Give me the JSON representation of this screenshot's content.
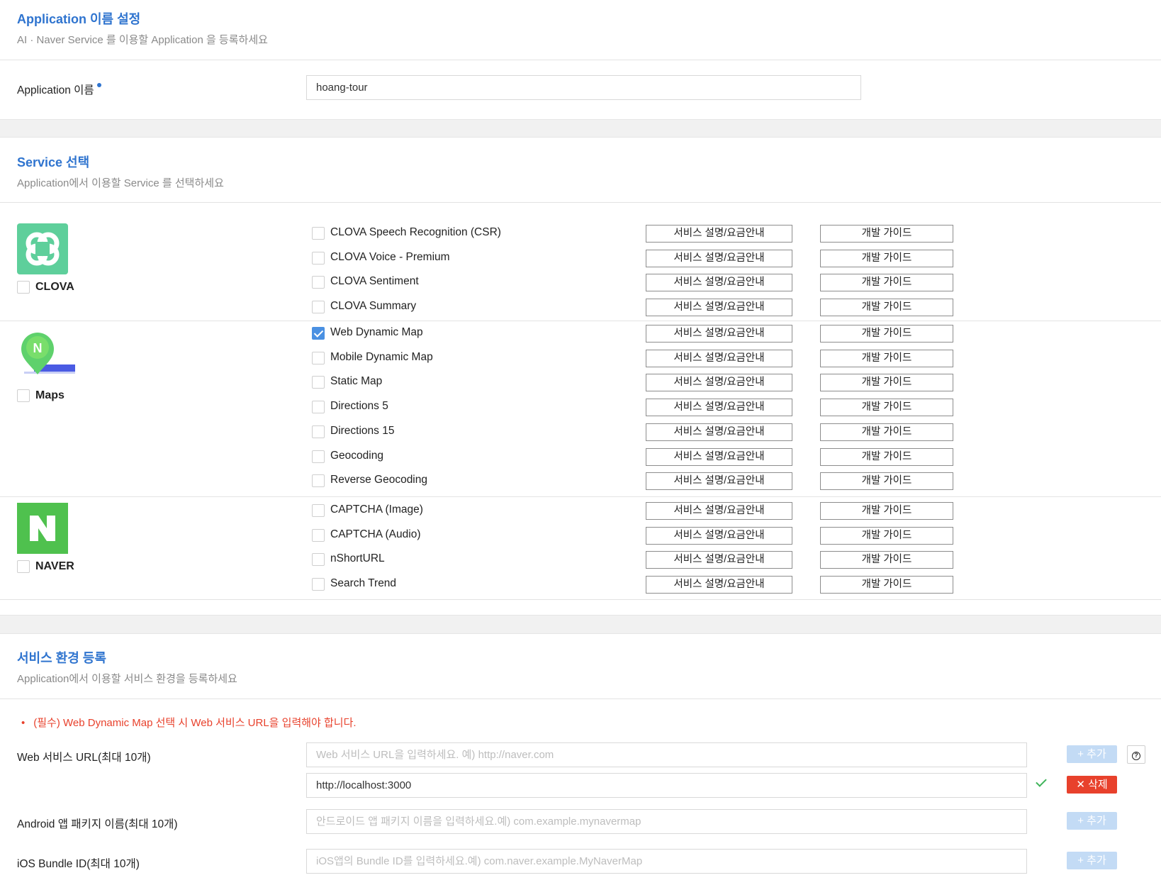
{
  "app_name_section": {
    "title": "Application 이름 설정",
    "desc": "AI · Naver Service 를 이용할 Application 을 등록하세요",
    "label": "Application 이름",
    "value": "hoang-tour"
  },
  "service_section": {
    "title": "Service 선택",
    "desc": "Application에서 이용할 Service 를 선택하세요",
    "desc_btn": "서비스 설명/요금안내",
    "guide_btn": "개발 가이드",
    "groups": [
      {
        "name": "CLOVA",
        "services": [
          {
            "name": "CLOVA Speech Recognition (CSR)",
            "checked": false
          },
          {
            "name": "CLOVA Voice - Premium",
            "checked": false
          },
          {
            "name": "CLOVA Sentiment",
            "checked": false
          },
          {
            "name": "CLOVA Summary",
            "checked": false
          }
        ]
      },
      {
        "name": "Maps",
        "services": [
          {
            "name": "Web Dynamic Map",
            "checked": true
          },
          {
            "name": "Mobile Dynamic Map",
            "checked": false
          },
          {
            "name": "Static Map",
            "checked": false
          },
          {
            "name": "Directions 5",
            "checked": false
          },
          {
            "name": "Directions 15",
            "checked": false
          },
          {
            "name": "Geocoding",
            "checked": false
          },
          {
            "name": "Reverse Geocoding",
            "checked": false
          }
        ]
      },
      {
        "name": "NAVER",
        "services": [
          {
            "name": "CAPTCHA (Image)",
            "checked": false
          },
          {
            "name": "CAPTCHA (Audio)",
            "checked": false
          },
          {
            "name": "nShortURL",
            "checked": false
          },
          {
            "name": "Search Trend",
            "checked": false
          }
        ]
      }
    ]
  },
  "env_section": {
    "title": "서비스 환경 등록",
    "desc": "Application에서 이용할 서비스 환경을 등록하세요",
    "warning": "(필수) Web Dynamic Map 선택 시 Web 서비스 URL을 입력해야 합니다.",
    "web_label": "Web 서비스 URL(최대 10개)",
    "web_placeholder": "Web 서비스 URL을 입력하세요. 예) http://naver.com",
    "web_value": "http://localhost:3000",
    "android_label": "Android 앱 패키지 이름(최대 10개)",
    "android_placeholder": "안드로이드 앱 패키지 이름을 입력하세요.예) com.example.mynavermap",
    "ios_label": "iOS Bundle ID(최대 10개)",
    "ios_placeholder": "iOS앱의 Bundle ID를 입력하세요.예) com.naver.example.MyNaverMap",
    "add_btn": "+ 추가",
    "delete_btn": "✕ 삭제",
    "help_icon": "?"
  },
  "colors": {
    "accent": "#2f74cf",
    "error": "#e8412c",
    "clova": "#5ecf9b",
    "naver": "#4fc14e",
    "add_btn": "#c3dbf5"
  }
}
